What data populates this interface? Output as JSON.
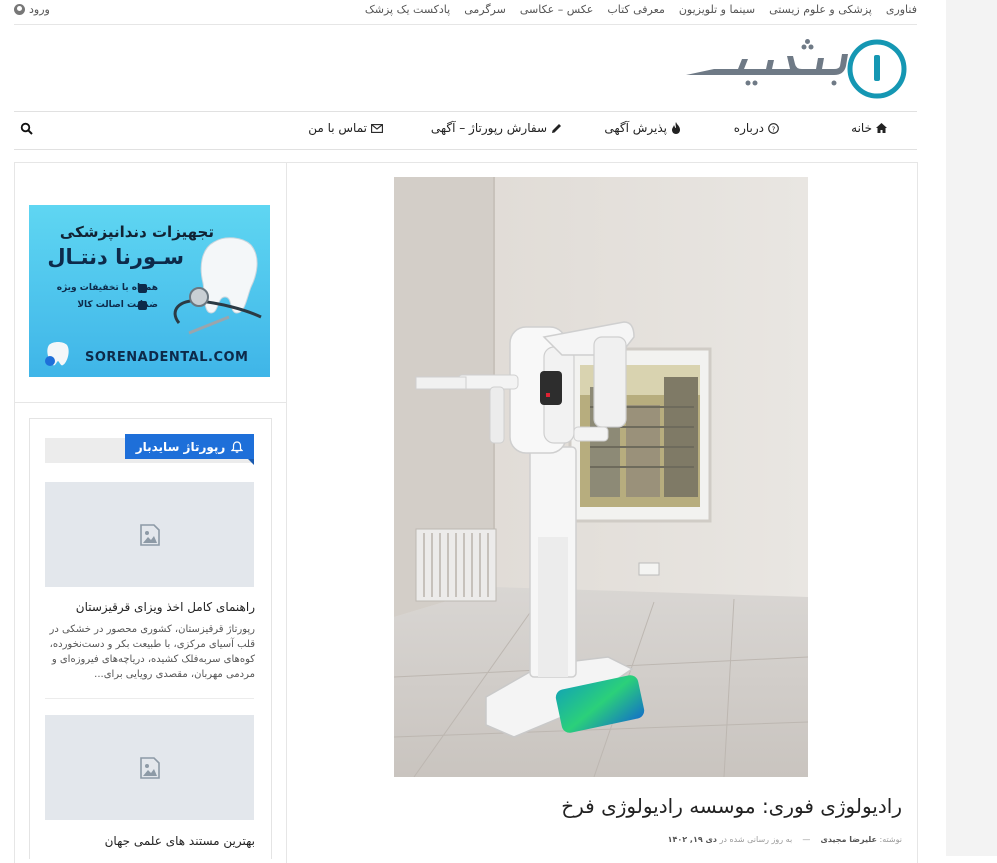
{
  "topbar": {
    "links": [
      "فناوری",
      "پزشکی و علوم زیستی",
      "سینما و تلویزیون",
      "معرفی کتاب",
      "عکس – عکاسی",
      "سرگرمی",
      "پادکست یک پزشک"
    ],
    "login_label": "ورود"
  },
  "main_nav": {
    "home": "خانه",
    "about": "درباره",
    "ads": "پذیرش آگهی",
    "report": "سفارش رپورتاژ – آگهی",
    "contact": "تماس با من"
  },
  "ad_banner": {
    "title": "تجهیزات دندانپزشکی",
    "brand": "سـورنا دنتـال",
    "line1": "همراه با تخفیفات ویژه",
    "line2": "ضمانت اصالت کالا",
    "domain": "SORENADENTAL.COM"
  },
  "widget": {
    "title": "رپورتاژ سایدبار",
    "posts": [
      {
        "title": "راهنمای کامل اخذ ویزای قرقیزستان",
        "excerpt": "رپورتاژ قرقیزستان، کشوری محصور در خشکی در قلب آسیای مرکزی، با طبیعت بکر و دست‌نخورده، کوه‌های سربه‌فلک کشیده، دریاچه‌های فیروزه‌ای و مردمی مهربان، مقصدی رویایی برای..."
      },
      {
        "title": "بهترین مستند های علمی جهان"
      }
    ]
  },
  "article": {
    "title": "رادیولوژی فوری: موسسه رادیولوژی فرخ",
    "meta_author_prefix": "نوشته:",
    "author": "علیرضا مجیدی",
    "dash": "—",
    "meta_date_prefix": "به روز رسانی شده در",
    "date": "دی ۱۹, ۱۴۰۲"
  },
  "colors": {
    "accent": "#1e6fd9",
    "logo_teal": "#1597b3",
    "logo_gray": "#6f7a86"
  },
  "icons": [
    "user-icon",
    "home-icon",
    "question-icon",
    "fire-icon",
    "pencil-icon",
    "envelope-icon",
    "search-icon",
    "bell-icon",
    "image-placeholder-icon"
  ]
}
